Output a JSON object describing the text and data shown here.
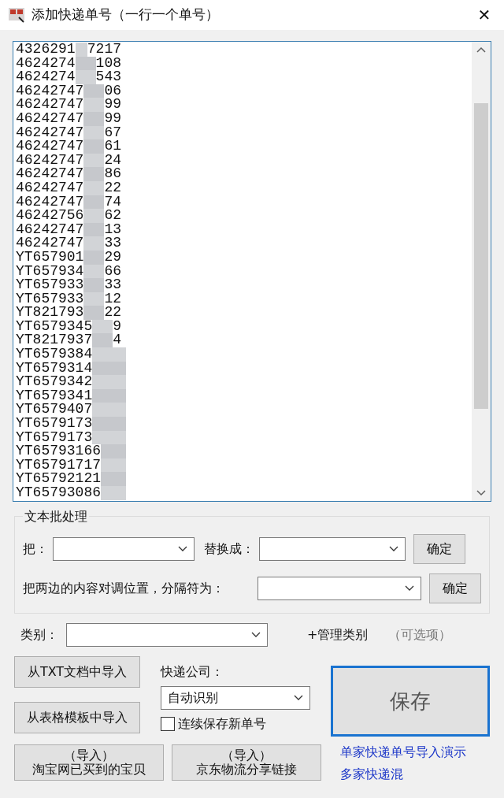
{
  "window": {
    "title": "添加快递单号（一行一个单号）",
    "close": "✕"
  },
  "numbers": [
    {
      "start": "4326291",
      "end": "7217"
    },
    {
      "start": "4624274",
      "end": "108"
    },
    {
      "start": "4624274",
      "end": "543"
    },
    {
      "start": "46242747",
      "end": "06"
    },
    {
      "start": "46242747",
      "end": "99"
    },
    {
      "start": "46242747",
      "end": "99"
    },
    {
      "start": "46242747",
      "end": "67"
    },
    {
      "start": "46242747",
      "end": "61"
    },
    {
      "start": "46242747",
      "end": "24"
    },
    {
      "start": "46242747",
      "end": "86"
    },
    {
      "start": "46242747",
      "end": "22"
    },
    {
      "start": "46242747",
      "end": "74"
    },
    {
      "start": "46242756",
      "end": "62"
    },
    {
      "start": "46242747",
      "end": "13"
    },
    {
      "start": "46242747",
      "end": "33"
    },
    {
      "start": "YT657901",
      "end": "29"
    },
    {
      "start": "YT657934",
      "end": "66"
    },
    {
      "start": "YT657933",
      "end": "33"
    },
    {
      "start": "YT657933",
      "end": "12"
    },
    {
      "start": "YT821793",
      "end": "22"
    },
    {
      "start": "YT6579345",
      "end": "9"
    },
    {
      "start": "YT8217937",
      "end": "4"
    },
    {
      "start": "YT6579384"
    },
    {
      "start": "YT6579314"
    },
    {
      "start": "YT6579342"
    },
    {
      "start": "YT6579341"
    },
    {
      "start": "YT6579407"
    },
    {
      "start": "YT6579173"
    },
    {
      "start": "YT6579173"
    },
    {
      "start": "YT65793166"
    },
    {
      "start": "YT65791717"
    },
    {
      "start": "YT65792121"
    },
    {
      "start": "YT65793086"
    }
  ],
  "batch": {
    "title": "文本批处理",
    "replace_label": "把：",
    "with_label": "替换成：",
    "confirm": "确定",
    "swap_label": "把两边的内容对调位置，分隔符为：",
    "swap_confirm": "确定"
  },
  "category": {
    "label": "类别：",
    "manage": "+管理类别",
    "optional": "（可选项）"
  },
  "import_txt": "从TXT文档中导入",
  "import_table": "从表格模板中导入",
  "courier": {
    "label": "快递公司：",
    "value": "自动识别"
  },
  "continuous": {
    "label": "连续保存新单号",
    "checked": false
  },
  "save": "保存",
  "import_taobao": [
    "（导入）",
    "淘宝网已买到的宝贝"
  ],
  "import_jd": [
    "（导入）",
    "京东物流分享链接"
  ],
  "links": [
    "单家快递单号导入演示",
    "多家快递混"
  ]
}
